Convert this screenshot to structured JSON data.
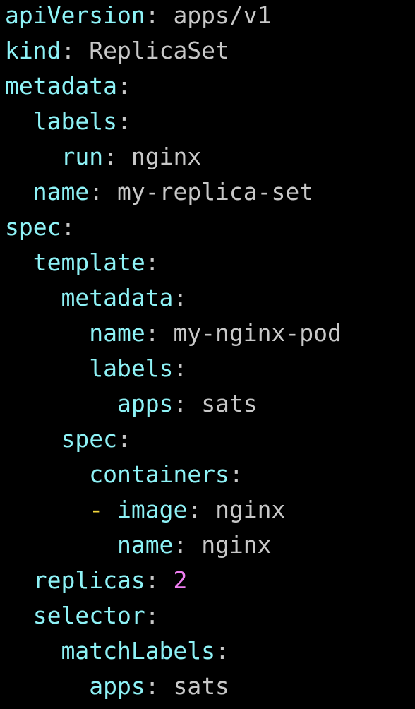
{
  "theme": {
    "background": "#000000",
    "key_color": "#8ef2f6",
    "value_color": "#c8c8c8",
    "number_color": "#ee7ef0",
    "dash_color": "#f2d63d"
  },
  "lines": [
    {
      "indent": 0,
      "dash": "",
      "key": "apiVersion",
      "value": "apps/v1",
      "vtype": "str"
    },
    {
      "indent": 0,
      "dash": "",
      "key": "kind",
      "value": "ReplicaSet",
      "vtype": "str"
    },
    {
      "indent": 0,
      "dash": "",
      "key": "metadata",
      "value": "",
      "vtype": "str"
    },
    {
      "indent": 1,
      "dash": "",
      "key": "labels",
      "value": "",
      "vtype": "str"
    },
    {
      "indent": 2,
      "dash": "",
      "key": "run",
      "value": "nginx",
      "vtype": "str"
    },
    {
      "indent": 1,
      "dash": "",
      "key": "name",
      "value": "my-replica-set",
      "vtype": "str"
    },
    {
      "indent": 0,
      "dash": "",
      "key": "spec",
      "value": "",
      "vtype": "str"
    },
    {
      "indent": 1,
      "dash": "",
      "key": "template",
      "value": "",
      "vtype": "str"
    },
    {
      "indent": 2,
      "dash": "",
      "key": "metadata",
      "value": "",
      "vtype": "str"
    },
    {
      "indent": 3,
      "dash": "",
      "key": "name",
      "value": "my-nginx-pod",
      "vtype": "str"
    },
    {
      "indent": 3,
      "dash": "",
      "key": "labels",
      "value": "",
      "vtype": "str"
    },
    {
      "indent": 4,
      "dash": "",
      "key": "apps",
      "value": "sats",
      "vtype": "str"
    },
    {
      "indent": 2,
      "dash": "",
      "key": "spec",
      "value": "",
      "vtype": "str"
    },
    {
      "indent": 3,
      "dash": "",
      "key": "containers",
      "value": "",
      "vtype": "str"
    },
    {
      "indent": 3,
      "dash": "-",
      "key": "image",
      "value": "nginx",
      "vtype": "str"
    },
    {
      "indent": 4,
      "dash": "",
      "key": "name",
      "value": "nginx",
      "vtype": "str"
    },
    {
      "indent": 1,
      "dash": "",
      "key": "replicas",
      "value": "2",
      "vtype": "num"
    },
    {
      "indent": 1,
      "dash": "",
      "key": "selector",
      "value": "",
      "vtype": "str"
    },
    {
      "indent": 2,
      "dash": "",
      "key": "matchLabels",
      "value": "",
      "vtype": "str"
    },
    {
      "indent": 3,
      "dash": "",
      "key": "apps",
      "value": "sats",
      "vtype": "str"
    }
  ]
}
